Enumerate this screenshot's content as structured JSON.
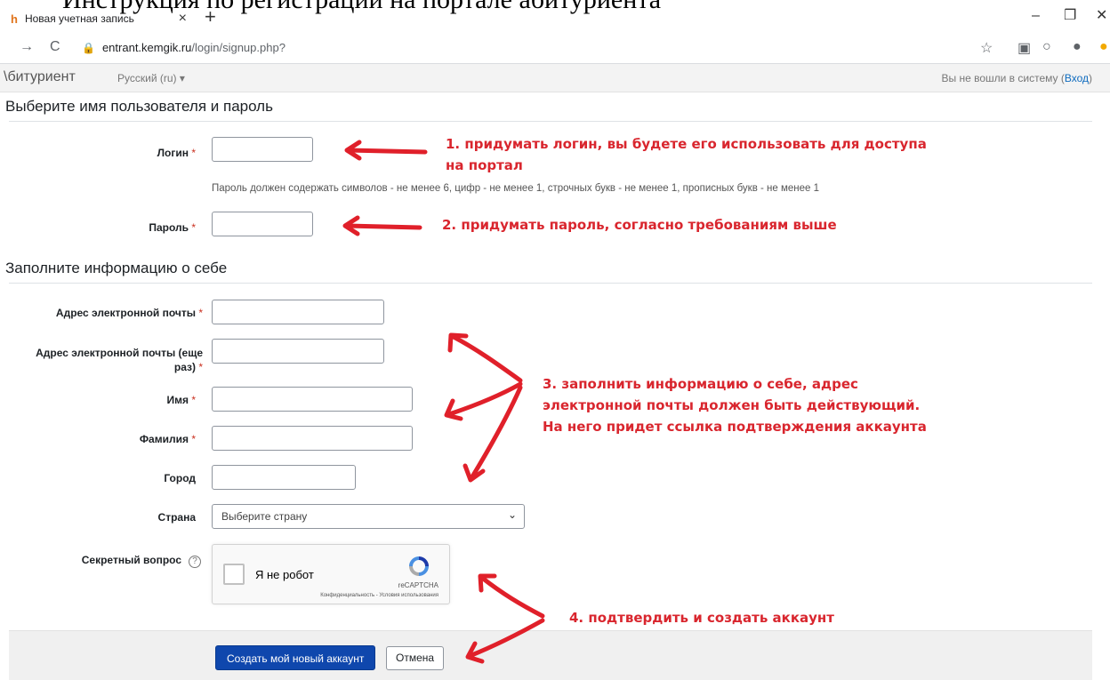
{
  "caption_text": "Инструкция по регистрации на портале абитуриента",
  "browser": {
    "tab_title": "Новая учетная запись",
    "tab_favicon": "h",
    "url_domain": "entrant.kemgik.ru",
    "url_path": "/login/signup.php?"
  },
  "navbar": {
    "brand": "\\битуриент",
    "language": "Русский (ru) ▾",
    "login_text": "Вы не вошли в систему (",
    "login_link": "Вход",
    "login_close": ")"
  },
  "sections": {
    "credentials_title": "Выберите имя пользователя и пароль",
    "info_title": "Заполните информацию о себе"
  },
  "form": {
    "login_label": "Логин",
    "password_hint": "Пароль должен содержать символов - не менее 6, цифр - не менее 1, строчных букв - не менее 1, прописных букв - не менее 1",
    "password_label": "Пароль",
    "email_label": "Адрес электронной почты",
    "email2_label_line1": "Адрес электронной почты (еще",
    "email2_label_line2": "раз)",
    "firstname_label": "Имя",
    "lastname_label": "Фамилия",
    "city_label": "Город",
    "country_label": "Страна",
    "country_value": "Выберите страну",
    "secret_label": "Секретный вопрос",
    "required_mark": "*",
    "help_mark": "?"
  },
  "recaptcha": {
    "checkbox_label": "Я не робот",
    "brand": "reCAPTCHA",
    "terms": "Конфиденциальность - Условия использования"
  },
  "buttons": {
    "submit": "Создать мой новый аккаунт",
    "cancel": "Отмена"
  },
  "annotations": {
    "step1_line1": "1. придумать логин, вы будете его использовать для доступа",
    "step1_line2": "на портал",
    "step2": "2. придумать пароль, согласно требованиям выше",
    "step3_line1": "3. заполнить информацию о себе, адрес",
    "step3_line2": "электронной почты должен быть действующий.",
    "step3_line3": "На него придет ссылка подтверждения аккаунта",
    "step4": "4. подтвердить и создать аккаунт"
  },
  "colors": {
    "annotation_red": "#d9262e",
    "primary_button": "#0f47ad",
    "required_red": "#ca3120"
  }
}
